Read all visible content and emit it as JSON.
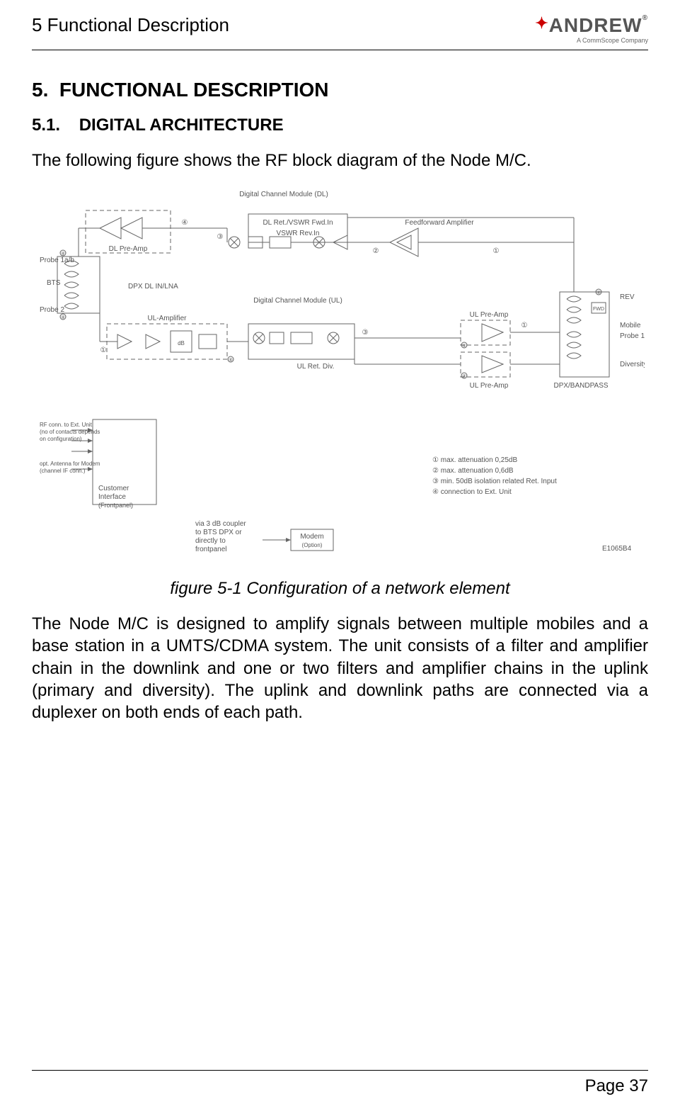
{
  "header": {
    "runningTitle": "5 Functional Description",
    "logoName": "ANDREW",
    "logoSub": "A CommScope Company"
  },
  "section": {
    "number": "5.",
    "title": "FUNCTIONAL DESCRIPTION"
  },
  "subsection": {
    "number": "5.1.",
    "title": "DIGITAL ARCHITECTURE"
  },
  "intro": "The following figure shows the RF block diagram of the Node M/C.",
  "figure": {
    "caption": "figure 5-1 Configuration of a network element",
    "labels": {
      "dcmDL": "Digital Channel Module (DL)",
      "dlRet": "DL Ret./VSWR Fwd.In",
      "vswrRev": "VSWR Rev.In",
      "ffAmp": "Feedforward Amplifier",
      "dlPreAmp": "DL Pre-Amp",
      "dpxDlInLna": "DPX DL IN/LNA",
      "probe1ab": "Probe 1a/b",
      "bts": "BTS",
      "probe2": "Probe 2",
      "ulAmp": "UL-Amplifier",
      "dcmUL": "Digital Channel Module (UL)",
      "ulRetDiv": "UL Ret. Div.",
      "ulPreAmp1": "UL Pre-Amp",
      "ulPreAmp2": "UL Pre-Amp",
      "rev": "REV",
      "fwd": "FWD",
      "mobile": "Mobile",
      "probe1": "Probe 1",
      "diversity": "Diversity",
      "dpxBandpass": "DPX/BANDPASS",
      "rfConn": "RF conn. to Ext. Unit (no of contacts depends on configuration)",
      "optAntenna": "opt. Antenna for Modem (channel IF conn.)",
      "customerInterface": "Customer Interface (Frontpanel)",
      "viaCoupler": "via 3 dB coupler to BTS DPX or directly to frontpanel",
      "modem": "Modem (Option)",
      "note1": "①  max. attenuation 0,25dB",
      "note2": "②  max. attenuation 0,6dB",
      "note3": "③  min. 50dB isolation related Ret. Input",
      "note4": "④  connection to Ext. Unit",
      "docId": "E1065B4"
    }
  },
  "bodyPara": "The Node M/C is designed to amplify signals between multiple mobiles and a base station in a UMTS/CDMA system. The unit consists of a filter and amplifier chain in the downlink and one or two filters and amplifier chains in the uplink (primary and diversity). The uplink and downlink paths are connected via a duplexer on both ends of each path.",
  "footer": {
    "pageLabel": "Page 37"
  }
}
